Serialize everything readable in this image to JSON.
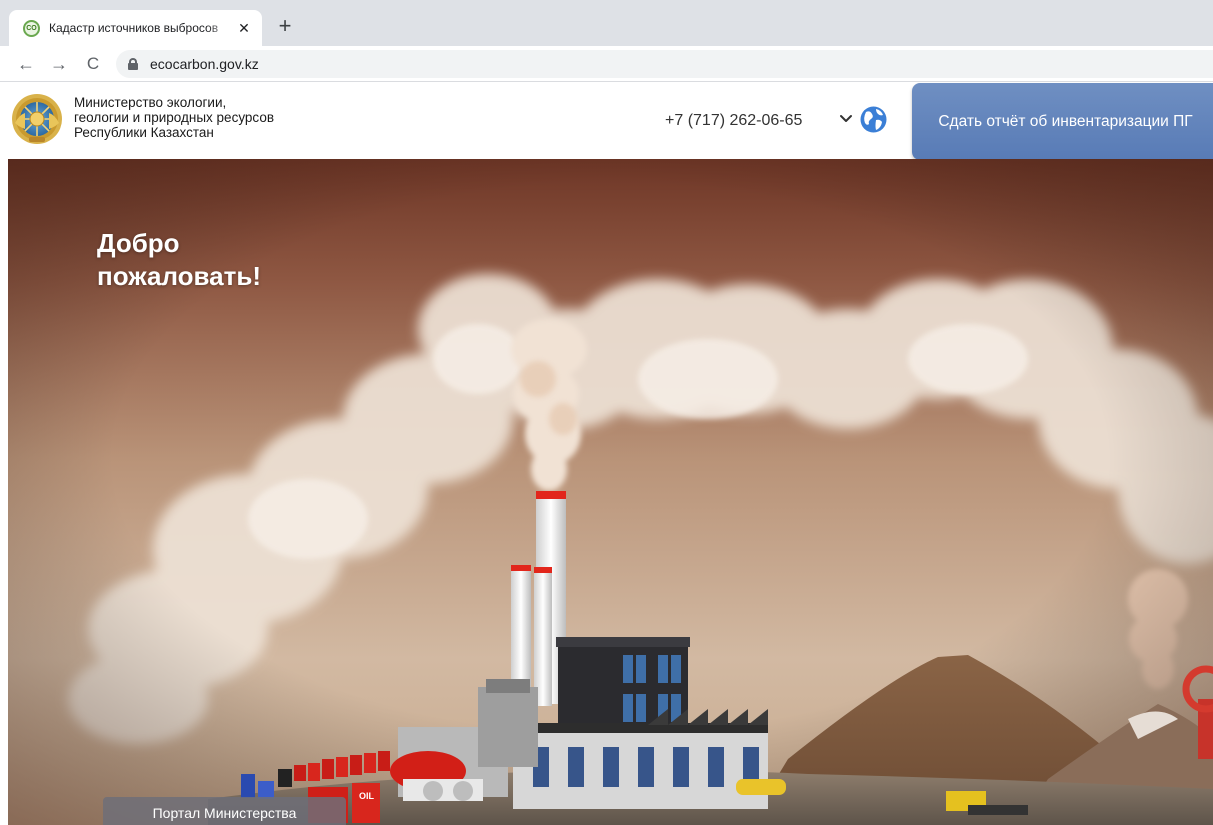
{
  "browser": {
    "tab": {
      "title": "Кадастр источников выбросов",
      "favicon": "eco-leaf-icon",
      "close_label": "✕"
    },
    "new_tab_label": "+",
    "nav": {
      "back": "←",
      "forward": "→",
      "reload": "C"
    },
    "url": "ecocarbon.gov.kz"
  },
  "header": {
    "ministry_lines": [
      "Министерство экологии,",
      "геологии и природных ресурсов",
      "Республики Казахстан"
    ],
    "phone": "+7 (717) 262-06-65",
    "language_icon": "globe-icon",
    "report_button": "Сдать отчёт об инвентаризации ПГ",
    "colors": {
      "report_button": "#6583bd"
    }
  },
  "hero": {
    "welcome_lines": [
      "Добро",
      "пожаловать!"
    ],
    "portal_button": "Портал Министерства",
    "barrel_label": "OIL",
    "colors": {
      "sky_top": "#7a3f2a",
      "sky_bottom": "#d6c0a8",
      "smoke": "#efe4d9"
    }
  }
}
